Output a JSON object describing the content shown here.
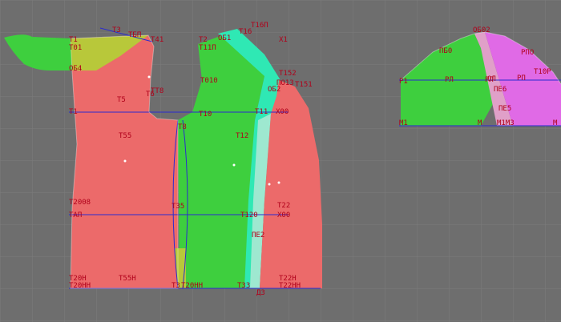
{
  "colors": {
    "background": "#6e6e6e",
    "grid": "#7c7c7c",
    "back_panel": "#ec6a6a",
    "front_panel": "#ec6a6a",
    "side_green": "#3ecf3e",
    "facing_cyan": "#2fe8b4",
    "facing_light": "#9ee8d0",
    "yoke_yellow": "#b8c83a",
    "sleeve_green": "#3ecf3e",
    "sleeve_magenta": "#e06ae6",
    "sleeve_pink": "#e0a0c8",
    "guide_line": "#2a2ad0",
    "label": "#b0001a"
  },
  "labels": [
    {
      "text": "Т1"
    },
    {
      "text": "Т3"
    },
    {
      "text": "Т01"
    },
    {
      "text": "ТБП"
    },
    {
      "text": "Т41"
    },
    {
      "text": "Т2"
    },
    {
      "text": "ОБ1"
    },
    {
      "text": "Т16"
    },
    {
      "text": "Т16П"
    },
    {
      "text": "Т11П"
    },
    {
      "text": "Х1"
    },
    {
      "text": "ОБ4"
    },
    {
      "text": "Т010"
    },
    {
      "text": "Т152"
    },
    {
      "text": "ПО13"
    },
    {
      "text": "Т151"
    },
    {
      "text": "ОБ2"
    },
    {
      "text": "ТТ8"
    },
    {
      "text": "Т6"
    },
    {
      "text": "Т5"
    },
    {
      "text": "Т1"
    },
    {
      "text": "Т8"
    },
    {
      "text": "Т10"
    },
    {
      "text": "Т11"
    },
    {
      "text": "Х00"
    },
    {
      "text": "Т55"
    },
    {
      "text": "Т12"
    },
    {
      "text": "Т2008"
    },
    {
      "text": "ТЗ5"
    },
    {
      "text": "Т22"
    },
    {
      "text": "ТАП"
    },
    {
      "text": "Т120"
    },
    {
      "text": "Х00"
    },
    {
      "text": "ПЕ2"
    },
    {
      "text": "Т20Н"
    },
    {
      "text": "Т55Н"
    },
    {
      "text": "Т22Н"
    },
    {
      "text": "Т20НН"
    },
    {
      "text": "Т3"
    },
    {
      "text": "Т22НН"
    },
    {
      "text": "Т33"
    },
    {
      "text": "Т20НН"
    },
    {
      "text": "Д3"
    },
    {
      "text": "ОБ02"
    },
    {
      "text": "ПБ0"
    },
    {
      "text": "РПО"
    },
    {
      "text": "Р1"
    },
    {
      "text": "РЛ"
    },
    {
      "text": "РЛ"
    },
    {
      "text": "Т10Р"
    },
    {
      "text": "ПЕ6"
    },
    {
      "text": "ОЛ"
    },
    {
      "text": "РП"
    },
    {
      "text": "ПЕ5"
    },
    {
      "text": "М1"
    },
    {
      "text": "М"
    },
    {
      "text": "М1М3"
    },
    {
      "text": "М"
    }
  ]
}
